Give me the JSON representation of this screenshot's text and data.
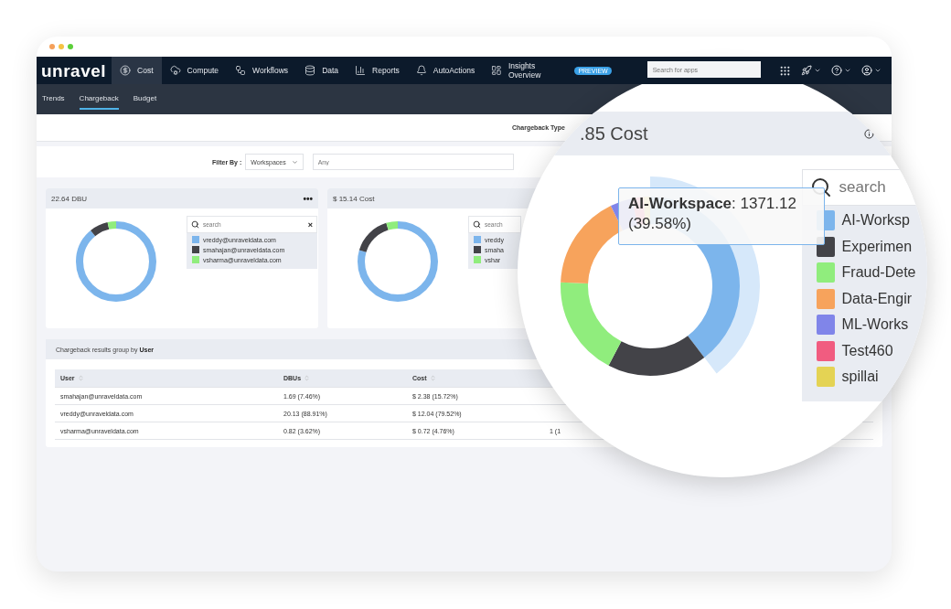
{
  "app": {
    "logo": "unravel",
    "nav": [
      {
        "label": "Cost",
        "selected": true
      },
      {
        "label": "Compute",
        "selected": false
      },
      {
        "label": "Workflows",
        "selected": false
      },
      {
        "label": "Data",
        "selected": false
      },
      {
        "label": "Reports",
        "selected": false
      },
      {
        "label": "AutoActions",
        "selected": false
      },
      {
        "label": "Insights Overview",
        "selected": false,
        "badge": "PREVIEW"
      }
    ],
    "search": {
      "placeholder": "Search for apps"
    },
    "subnav": [
      {
        "label": "Trends",
        "selected": false
      },
      {
        "label": "Chargeback",
        "selected": true
      },
      {
        "label": "Budget",
        "selected": false
      }
    ]
  },
  "header": {
    "label": "Chargeback Type"
  },
  "filter": {
    "label": "Filter By :",
    "select": "Workspaces",
    "input_placeholder": "Any"
  },
  "cards": [
    {
      "title": "22.64 DBU",
      "menu": "•••",
      "search_placeholder": "search",
      "clear": "×",
      "legend": [
        {
          "label": "vreddy@unraveldata.com",
          "color": "#7cb5ec"
        },
        {
          "label": "smahajan@unraveldata.com",
          "color": "#434348"
        },
        {
          "label": "vsharma@unraveldata.com",
          "color": "#90ed7d"
        }
      ]
    },
    {
      "title": "$ 15.14 Cost",
      "search_placeholder": "search",
      "legend": [
        {
          "label": "vreddy",
          "color": "#7cb5ec"
        },
        {
          "label": "smaha",
          "color": "#434348"
        },
        {
          "label": "vshar",
          "color": "#90ed7d"
        }
      ]
    }
  ],
  "results": {
    "title": "Chargeback results group by **User**",
    "columns": [
      "User",
      "DBUs",
      "Cost"
    ],
    "rows": [
      {
        "user": "smahajan@unraveldata.com",
        "dbus": "1.69 (7.46%)",
        "cost": "$ 2.38 (15.72%)"
      },
      {
        "user": "vreddy@unraveldata.com",
        "dbus": "20.13 (88.91%)",
        "cost": "$ 12.04 (79.52%)"
      },
      {
        "user": "vsharma@unraveldata.com",
        "dbus": "0.82 (3.62%)",
        "cost": "$ 0.72 (4.76%)",
        "column_4": "1 (1"
      }
    ]
  },
  "magnifier": {
    "title": ".85 Cost",
    "search_placeholder": "search",
    "tooltip": "**AI-Workspace**: 1371.12 (39.58%)",
    "legend": [
      {
        "label": "AI-Worksp",
        "color": "#7cb5ec"
      },
      {
        "label": "Experimen",
        "color": "#434348"
      },
      {
        "label": "Fraud-Dete",
        "color": "#90ed7d"
      },
      {
        "label": "Data-Engir",
        "color": "#f7a35c"
      },
      {
        "label": "ML-Works",
        "color": "#8085e9"
      },
      {
        "label": "Test460",
        "color": "#f15c80"
      },
      {
        "label": "spillai",
        "color": "#e4d354"
      }
    ]
  }
}
